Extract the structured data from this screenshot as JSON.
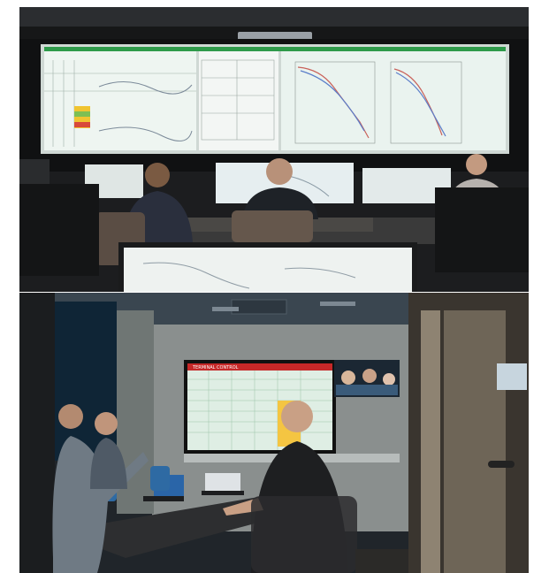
{
  "page": {
    "background": "#ffffff"
  },
  "photos": [
    {
      "id": "control-room",
      "subject": "operators at desks facing a wide video wall of engineering plots"
    },
    {
      "id": "meeting-room",
      "subject": "four people at a table facing a large display with a spreadsheet and a video call"
    }
  ],
  "screen_text": {
    "meeting_display_header": "TERMINAL CONTROL"
  },
  "colors": {
    "video_wall": "#e9f2ee",
    "spreadsheet_header": "#c62828",
    "spreadsheet_grid": "#cfe8d7",
    "spreadsheet_highlight": "#f4c542",
    "room_dark": "#1f2326",
    "ceiling": "#3a4650"
  },
  "icons": [
    "video-wall",
    "monitor",
    "laptop",
    "office-chair",
    "spreadsheet",
    "video-call"
  ]
}
